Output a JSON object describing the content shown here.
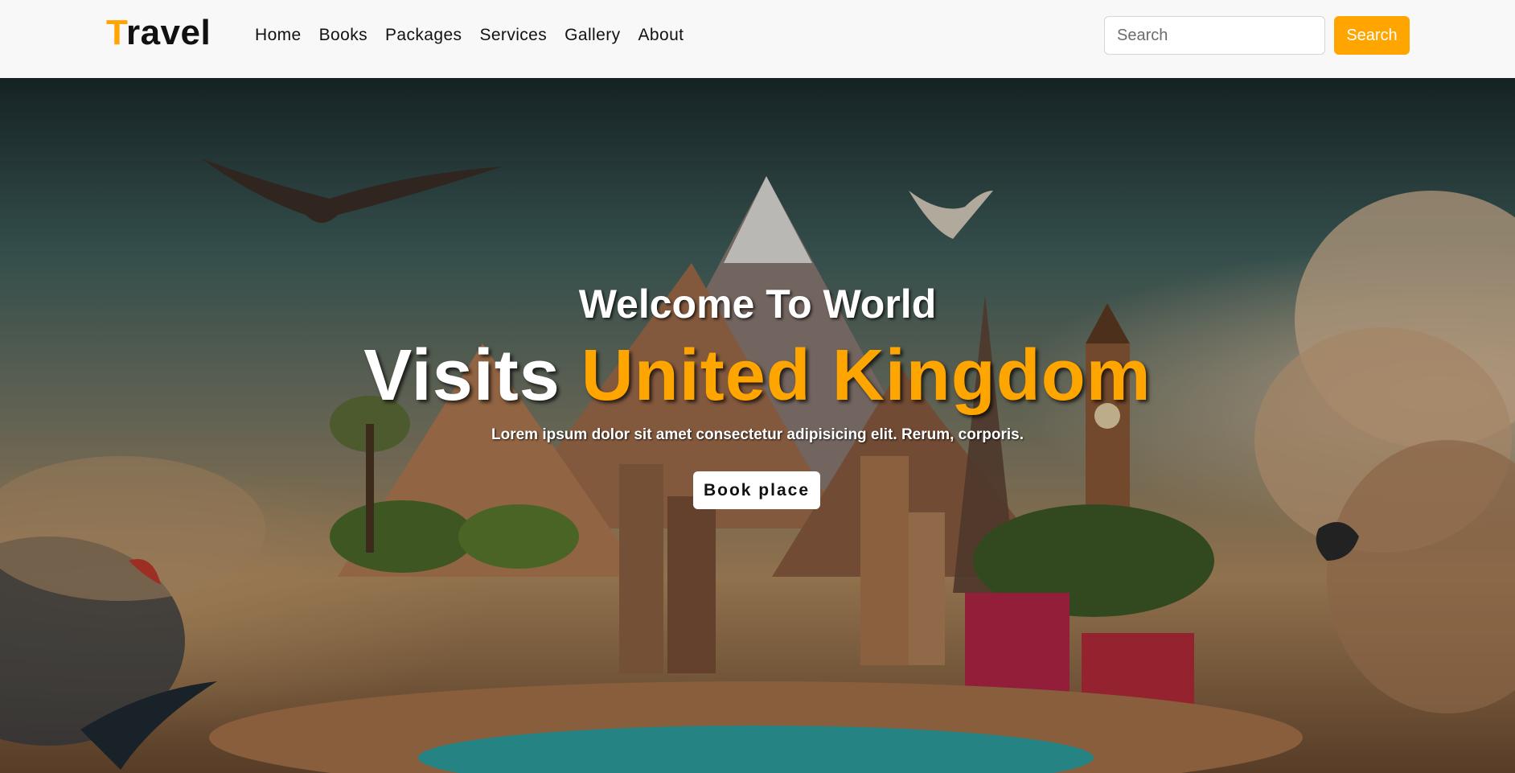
{
  "brand": {
    "first_letter": "T",
    "rest": "ravel"
  },
  "nav": {
    "items": [
      {
        "label": "Home"
      },
      {
        "label": "Books"
      },
      {
        "label": "Packages"
      },
      {
        "label": "Services"
      },
      {
        "label": "Gallery"
      },
      {
        "label": "About"
      }
    ]
  },
  "search": {
    "placeholder": "Search",
    "value": "",
    "button_label": "Search"
  },
  "hero": {
    "subtitle": "Welcome To World",
    "headline_prefix": "Visits ",
    "headline_accent": "United Kingdom",
    "description": "Lorem ipsum dolor sit amet consectetur adipisicing elit. Rerum, corporis.",
    "cta_label": "Book place"
  },
  "colors": {
    "accent": "#ffa500",
    "navbar_bg": "#f8f8f8"
  }
}
